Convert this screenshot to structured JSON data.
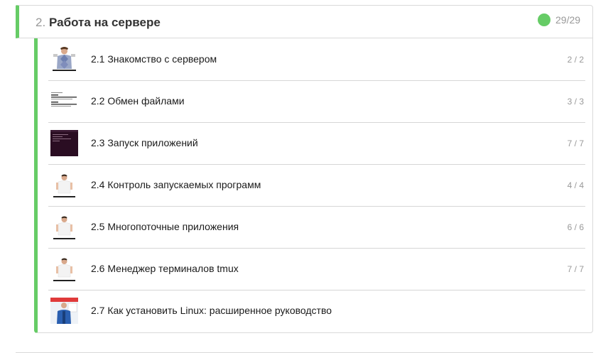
{
  "module": {
    "number": "2.",
    "title": "Работа на сервере",
    "progress": "29/29",
    "status_color": "#66cc66"
  },
  "lessons": [
    {
      "title": "2.1 Знакомство с сервером",
      "progress": "2 / 2",
      "thumb": "person-argyle-sweater"
    },
    {
      "title": "2.2 Обмен файлами",
      "progress": "3 / 3",
      "thumb": "text-document"
    },
    {
      "title": "2.3 Запуск приложений",
      "progress": "7 / 7",
      "thumb": "dark-terminal"
    },
    {
      "title": "2.4 Контроль запускаемых программ",
      "progress": "4 / 4",
      "thumb": "person-white-shirt"
    },
    {
      "title": "2.5 Многопоточные приложения",
      "progress": "6 / 6",
      "thumb": "person-white-shirt"
    },
    {
      "title": "2.6 Менеджер терминалов tmux",
      "progress": "7 / 7",
      "thumb": "person-white-shirt"
    },
    {
      "title": "2.7 Как установить Linux: расширенное руководство",
      "progress": "",
      "thumb": "person-blue-jacket"
    }
  ]
}
